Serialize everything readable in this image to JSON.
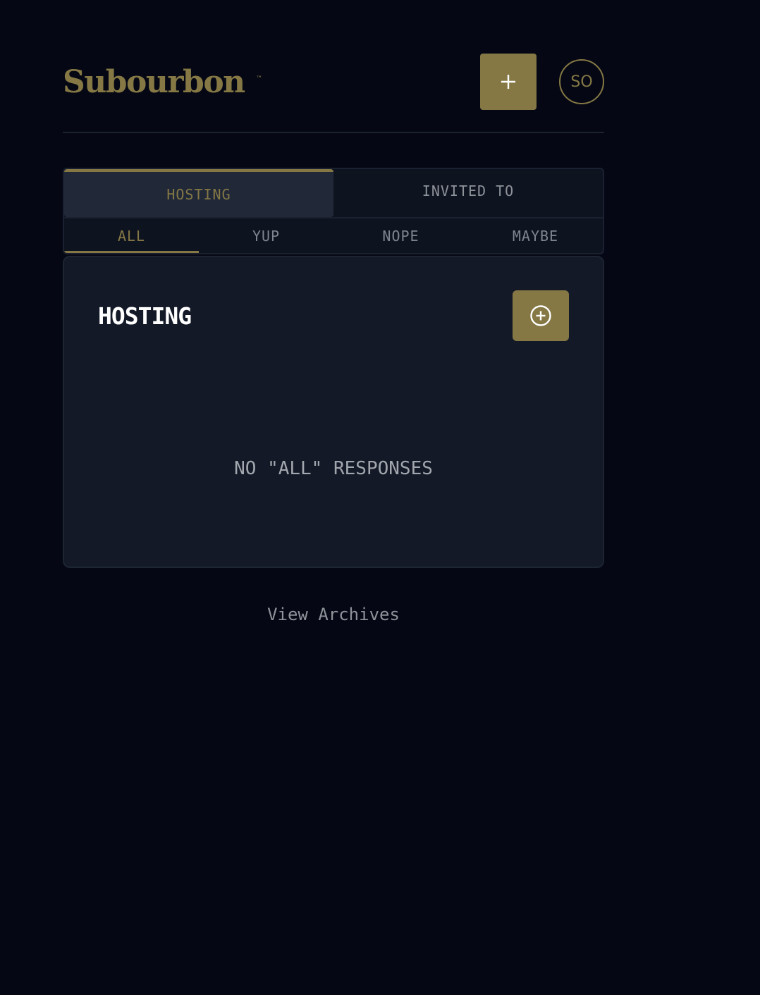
{
  "app": {
    "logo": "Subourbon",
    "logo_mark": "™"
  },
  "header": {
    "add_icon": "plus-icon",
    "avatar_initials": "SO"
  },
  "tabs": {
    "main": [
      {
        "label": "HOSTING",
        "active": true
      },
      {
        "label": "INVITED TO",
        "active": false
      }
    ],
    "sub": [
      {
        "label": "ALL",
        "active": true
      },
      {
        "label": "YUP",
        "active": false
      },
      {
        "label": "NOPE",
        "active": false
      },
      {
        "label": "MAYBE",
        "active": false
      }
    ]
  },
  "card": {
    "title": "HOSTING",
    "add_icon": "plus-circle-icon",
    "empty_message": "NO \"ALL\" RESPONSES"
  },
  "footer": {
    "archives_link": "View Archives"
  },
  "colors": {
    "background": "#050814",
    "accent": "#857845",
    "card": "#131927",
    "tab_active": "#212938"
  }
}
